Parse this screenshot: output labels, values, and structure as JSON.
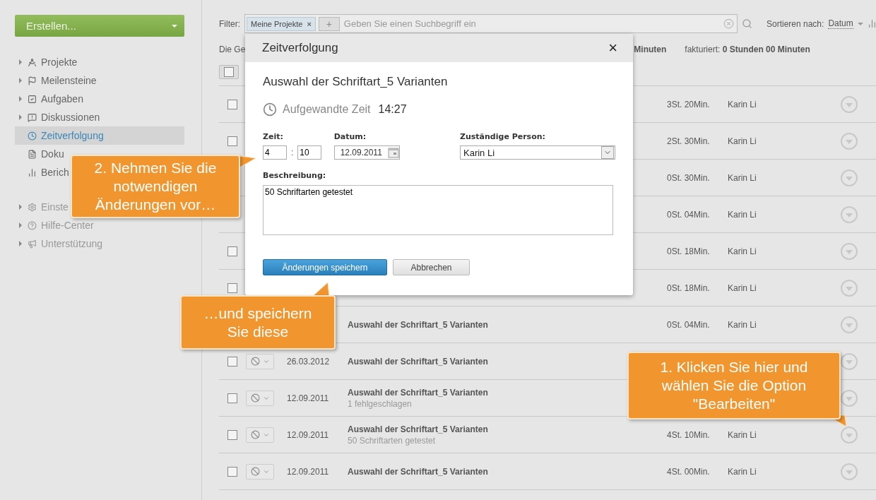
{
  "sidebar": {
    "create_button": "Erstellen...",
    "items": [
      {
        "label": "Projekte",
        "kind": "group",
        "selected": false
      },
      {
        "label": "Meilensteine",
        "kind": "group",
        "selected": false
      },
      {
        "label": "Aufgaben",
        "kind": "group",
        "selected": false
      },
      {
        "label": "Diskussionen",
        "kind": "group",
        "selected": false
      },
      {
        "label": "Zeitverfolgung",
        "kind": "link",
        "selected": true
      },
      {
        "label": "Doku",
        "kind": "link",
        "selected": false
      },
      {
        "label": "Berich",
        "kind": "link",
        "selected": false
      }
    ],
    "secondary_items": [
      {
        "label": "Einste",
        "kind": "group"
      },
      {
        "label": "Hilfe-Center",
        "kind": "group"
      },
      {
        "label": "Unterstützung",
        "kind": "group"
      }
    ]
  },
  "filter": {
    "label": "Filter:",
    "tag": "Meine Projekte",
    "tag_remove": "×",
    "add": "+",
    "placeholder": "Geben Sie einen Suchbegriff ein",
    "sort_label": "Sortieren nach:",
    "sort_value": "Datum"
  },
  "summary": {
    "label": "Die Ge",
    "total_tail": "Minuten",
    "billed_label": "fakturiert:",
    "billed_value": "0 Stunden 00 Minuten"
  },
  "rows": [
    {
      "checked": false,
      "time": "3St. 20Min.",
      "person": "Karin Li"
    },
    {
      "checked": false,
      "time": "2St. 30Min.",
      "person": "Karin Li"
    },
    {
      "time": "0St. 30Min.",
      "person": "Karin Li"
    },
    {
      "time": "0St. 04Min.",
      "person": "Karin Li"
    },
    {
      "checked": false,
      "time": "0St. 18Min.",
      "person": "Karin Li"
    },
    {
      "checked": false,
      "time": "0St. 18Min.",
      "person": "Karin Li"
    },
    {
      "title": "Auswahl der Schriftart_5 Varianten",
      "time": "0St. 04Min.",
      "person": "Karin Li"
    },
    {
      "checked": false,
      "status": true,
      "date": "26.03.2012",
      "title": "Auswahl der Schriftart_5 Varianten"
    },
    {
      "checked": false,
      "status": true,
      "date": "12.09.2011",
      "title": "Auswahl der Schriftart_5 Varianten",
      "note": "1 fehlgeschlagen"
    },
    {
      "checked": false,
      "status": true,
      "date": "12.09.2011",
      "title": "Auswahl der Schriftart_5 Varianten",
      "note": "50 Schriftarten getestet",
      "time": "4St. 10Min.",
      "person": "Karin Li"
    },
    {
      "checked": false,
      "status": true,
      "date": "12.09.2011",
      "title": "Auswahl der Schriftart_5 Varianten",
      "time": "4St. 00Min.",
      "person": "Karin Li"
    }
  ],
  "dialog": {
    "title": "Zeitverfolgung",
    "close": "×",
    "task": "Auswahl der Schriftart_5 Varianten",
    "spent_label": "Aufgewandte Zeit",
    "spent_value": "14:27",
    "time_label": "Zeit:",
    "hours": "4",
    "separator": ":",
    "minutes": "10",
    "date_label": "Datum:",
    "date": "12.09.2011",
    "person_label": "Zuständige Person:",
    "person": "Karin Li",
    "description_label": "Beschreibung:",
    "description": "50 Schriftarten getestet",
    "save": "Änderungen speichern",
    "cancel": "Abbrechen"
  },
  "callouts": [
    {
      "text": "2. Nehmen Sie die notwendigen Änderungen vor…",
      "kind": "right"
    },
    {
      "text": "…und speichern Sie diese",
      "kind": "up"
    },
    {
      "text": "1. Klicken Sie hier und wählen Sie die Option \"Bearbeiten\"",
      "kind": "down"
    }
  ]
}
